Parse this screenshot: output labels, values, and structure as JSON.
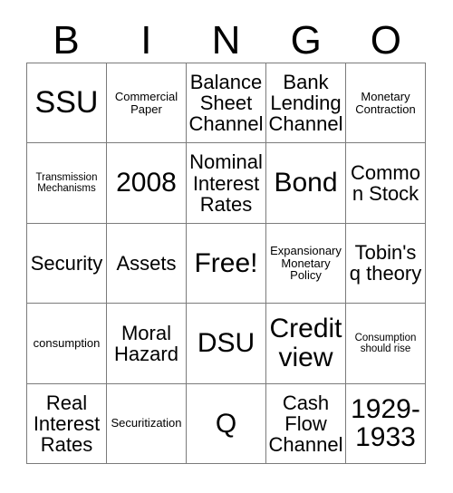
{
  "card": {
    "headers": [
      "B",
      "I",
      "N",
      "G",
      "O"
    ],
    "rows": [
      [
        {
          "text": "SSU",
          "size": "xxl"
        },
        {
          "text": "Commercial Paper",
          "size": "xs"
        },
        {
          "text": "Balance Sheet Channel",
          "size": "md"
        },
        {
          "text": "Bank Lending Channel",
          "size": "md"
        },
        {
          "text": "Monetary Contraction",
          "size": "xs"
        }
      ],
      [
        {
          "text": "Transmission Mechanisms",
          "size": "xxs"
        },
        {
          "text": "2008",
          "size": "xl"
        },
        {
          "text": "Nominal Interest Rates",
          "size": "md"
        },
        {
          "text": "Bond",
          "size": "xl"
        },
        {
          "text": "Common Stock",
          "size": "md"
        }
      ],
      [
        {
          "text": "Security",
          "size": "md"
        },
        {
          "text": "Assets",
          "size": "md"
        },
        {
          "text": "Free!",
          "size": "xl"
        },
        {
          "text": "Expansionary Monetary Policy",
          "size": "xs"
        },
        {
          "text": "Tobin's q theory",
          "size": "md"
        }
      ],
      [
        {
          "text": "consumption",
          "size": "xs"
        },
        {
          "text": "Moral Hazard",
          "size": "md"
        },
        {
          "text": "DSU",
          "size": "xl"
        },
        {
          "text": "Credit view",
          "size": "xl"
        },
        {
          "text": "Consumption should rise",
          "size": "xxs"
        }
      ],
      [
        {
          "text": "Real Interest Rates",
          "size": "md"
        },
        {
          "text": "Securitization",
          "size": "xs"
        },
        {
          "text": "Q",
          "size": "xl"
        },
        {
          "text": "Cash Flow Channel",
          "size": "md"
        },
        {
          "text": "1929-1933",
          "size": "xl"
        }
      ]
    ]
  },
  "colors": {
    "grid_line": "#7b7b7b",
    "text": "#000000",
    "background": "#ffffff"
  }
}
